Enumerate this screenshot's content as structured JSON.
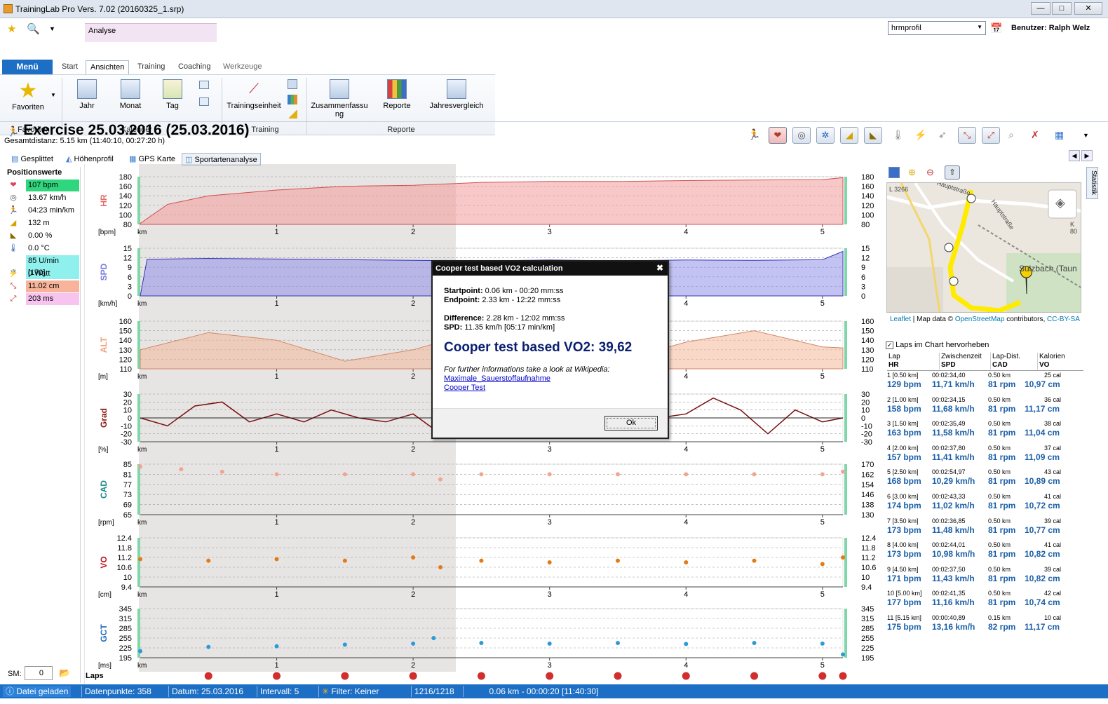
{
  "window": {
    "title": "TrainingLab Pro Vers. 7.02 (20160325_1.srp)",
    "min": "—",
    "max": "□",
    "close": "✕"
  },
  "ribbon": {
    "context_tab": "Analyse",
    "menu": "Menü",
    "tabs": [
      "Start",
      "Ansichten",
      "Training",
      "Coaching",
      "Werkzeuge"
    ],
    "profile": "hrmprofil",
    "user": "Benutzer: Ralph Welz",
    "buttons": {
      "favoriten": "Favoriten",
      "jahr": "Jahr",
      "monat": "Monat",
      "tag": "Tag",
      "trainingseinheit": "Trainingseinheit",
      "zusammenfassung": "Zusammenfassu\nng",
      "reporte": "Reporte",
      "jahresvergleich": "Jahresvergleich"
    },
    "groups": {
      "favoriten": "Favoriten",
      "kalender": "Kalender",
      "training": "Training",
      "reporte": "Reporte"
    }
  },
  "exercise": {
    "title": "Exercise 25.03.2016 (25.03.2016)",
    "subtitle": "Gesamtdistanz: 5.15 km (11:40:10, 00:27:20 h)"
  },
  "subtabs": [
    "Gesplittet",
    "Höhenprofil",
    "GPS Karte",
    "Sportartenanalyse"
  ],
  "positions": {
    "title": "Positionswerte",
    "rows": [
      {
        "icon": "heart-icon",
        "value": "107 bpm",
        "bg": "#2fd67e"
      },
      {
        "icon": "speed-icon",
        "value": "13.67 km/h",
        "bg": ""
      },
      {
        "icon": "runner-icon",
        "value": "04:23 min/km",
        "bg": ""
      },
      {
        "icon": "altitude-icon",
        "value": "132 m",
        "bg": ""
      },
      {
        "icon": "gradient-icon",
        "value": "0.00 %",
        "bg": ""
      },
      {
        "icon": "thermometer-icon",
        "value": "0.0 °C",
        "bg": ""
      },
      {
        "icon": "cadence-icon",
        "value": "85 U/min [170]",
        "bg": "#8ff0ee"
      },
      {
        "icon": "power-icon",
        "value": "0 Watt",
        "bg": ""
      },
      {
        "icon": "vertical-oscillation-icon",
        "value": "11.02 cm",
        "bg": "#f7b49a"
      },
      {
        "icon": "ground-contact-icon",
        "value": "203 ms",
        "bg": "#f7c3ef"
      }
    ]
  },
  "sm": {
    "label": "SM:",
    "value": "0"
  },
  "laps_label": "Laps",
  "chart_data": [
    {
      "type": "area",
      "name": "HR",
      "unit": "[bpm]",
      "ylim": [
        80,
        180
      ],
      "yticks": [
        80,
        100,
        120,
        140,
        160,
        180
      ],
      "xlabel": "km",
      "xticks": [
        1,
        2,
        3,
        4,
        5
      ],
      "x": [
        0,
        0.2,
        0.5,
        1,
        1.5,
        2,
        2.5,
        3,
        3.5,
        4,
        4.5,
        5,
        5.15
      ],
      "y": [
        82,
        122,
        140,
        152,
        160,
        162,
        168,
        170,
        170,
        172,
        173,
        174,
        178
      ]
    },
    {
      "type": "area",
      "name": "SPD",
      "unit": "[km/h]",
      "ylim": [
        0,
        15
      ],
      "yticks": [
        0,
        3,
        6,
        9,
        12,
        15
      ],
      "xlabel": "km",
      "xticks": [
        1,
        2,
        3,
        4,
        5
      ],
      "x": [
        0,
        0.05,
        0.5,
        1,
        1.5,
        2,
        2.5,
        3,
        3.5,
        4,
        4.5,
        5,
        5.15
      ],
      "y": [
        0,
        11.5,
        11.8,
        11.6,
        11.4,
        11.2,
        11.0,
        11.3,
        11.0,
        11.3,
        11.2,
        11.4,
        14
      ]
    },
    {
      "type": "area",
      "name": "ALT",
      "unit": "[m]",
      "ylim": [
        110,
        160
      ],
      "yticks": [
        110,
        120,
        130,
        140,
        150,
        160
      ],
      "xlabel": "km",
      "xticks": [
        1,
        2,
        3,
        4,
        5
      ],
      "x": [
        0,
        0.5,
        1,
        1.5,
        2,
        2.5,
        3,
        3.5,
        4,
        4.5,
        5,
        5.15
      ],
      "y": [
        130,
        148,
        140,
        118,
        130,
        150,
        148,
        118,
        138,
        150,
        133,
        132
      ]
    },
    {
      "type": "line",
      "name": "Grad",
      "unit": "[%]",
      "ylim": [
        -30,
        30
      ],
      "yticks": [
        -30,
        -20,
        -10,
        0,
        10,
        20,
        30
      ],
      "xlabel": "km",
      "xticks": [
        1,
        2,
        3,
        4,
        5
      ],
      "x": [
        0,
        0.2,
        0.4,
        0.6,
        0.8,
        1,
        1.2,
        1.4,
        1.6,
        1.8,
        2,
        2.2,
        2.4,
        2.6,
        2.8,
        3,
        3.2,
        3.4,
        3.6,
        3.8,
        4,
        4.2,
        4.4,
        4.6,
        4.8,
        5,
        5.15
      ],
      "y": [
        0,
        -10,
        15,
        20,
        -5,
        5,
        -5,
        10,
        0,
        -5,
        5,
        -20,
        20,
        -10,
        5,
        0,
        -5,
        5,
        -10,
        0,
        5,
        25,
        10,
        -20,
        10,
        -5,
        0
      ]
    },
    {
      "type": "scatter",
      "name": "CAD",
      "unit": "[rpm]",
      "ylim": [
        65,
        85
      ],
      "yticks": [
        65,
        69,
        73,
        77,
        81,
        85
      ],
      "y2ticks": [
        130,
        138,
        146,
        154,
        162,
        170
      ],
      "xlabel": "km",
      "xticks": [
        1,
        2,
        3,
        4,
        5
      ],
      "x": [
        0,
        0.3,
        0.6,
        1,
        1.5,
        2,
        2.2,
        2.5,
        3,
        3.5,
        4,
        4.5,
        5,
        5.15
      ],
      "y": [
        84,
        83,
        82,
        81,
        81,
        81,
        79,
        81,
        81,
        81,
        81,
        81,
        81,
        82
      ]
    },
    {
      "type": "scatter",
      "name": "VO",
      "unit": "[cm]",
      "ylim": [
        9.4,
        12.4
      ],
      "yticks": [
        9.4,
        10,
        10.6,
        11.2,
        11.8,
        12.4
      ],
      "xlabel": "km",
      "xticks": [
        1,
        2,
        3,
        4,
        5
      ],
      "x": [
        0,
        0.5,
        1,
        1.5,
        2,
        2.2,
        2.5,
        3,
        3.5,
        4,
        4.5,
        5,
        5.15
      ],
      "y": [
        11.1,
        11.0,
        11.1,
        11.0,
        11.2,
        10.6,
        11.0,
        10.9,
        11.0,
        10.9,
        11.0,
        10.8,
        11.2
      ]
    },
    {
      "type": "scatter",
      "name": "GCT",
      "unit": "[ms]",
      "ylim": [
        195,
        345
      ],
      "yticks": [
        195,
        225,
        255,
        285,
        315,
        345
      ],
      "xlabel": "km",
      "xticks": [
        1,
        2,
        3,
        4,
        5
      ],
      "x": [
        0,
        0.5,
        1,
        1.5,
        2,
        2.15,
        2.5,
        3,
        3.5,
        4,
        4.5,
        5,
        5.15
      ],
      "y": [
        215,
        228,
        230,
        235,
        238,
        255,
        240,
        238,
        240,
        237,
        240,
        238,
        205
      ]
    }
  ],
  "dialog": {
    "title": "Cooper test based VO2 calculation",
    "close": "✖",
    "startpoint_label": "Startpoint:",
    "startpoint": " 0.06 km - 00:20 mm:ss",
    "endpoint_label": "Endpoint:",
    "endpoint": " 2.33 km - 12:22 mm:ss",
    "difference_label": "Difference:",
    "difference": " 2.28 km - 12:02 mm:ss",
    "spd_label": "SPD:",
    "spd": " 11.35 km/h [05:17 min/km]",
    "result": "Cooper test based VO2: 39,62",
    "info": "For further informations take a look at Wikipedia:",
    "link1": "Maximale_Sauerstoffaufnahme",
    "link2": "Cooper Test",
    "ok": "Ok"
  },
  "map": {
    "attribution_leaflet": "Leaflet",
    "attribution_text": " | Map data © ",
    "osm": "OpenStreetMap",
    "contributors": " contributors, ",
    "ccbysa": "CC-BY-SA",
    "streets": [
      "Hauptstraße",
      "Hauptstraße",
      "L 3266",
      "Sulzbach (Taun",
      "K 80"
    ]
  },
  "laps": {
    "checkbox": "Laps im Chart hervorheben",
    "headers": [
      [
        "Lap",
        "HR"
      ],
      [
        "Zwischenzeit",
        "SPD"
      ],
      [
        "Lap-Dist.",
        "CAD"
      ],
      [
        "Kalorien",
        "VO"
      ]
    ],
    "rows": [
      {
        "lap": "1 [0.50 km]",
        "time": "00:02:34,40",
        "dist": "0.50 km",
        "cal": "25 cal",
        "hr": "129 bpm",
        "spd": "11,71 km/h",
        "cad": "81 rpm",
        "vo": "10,97 cm"
      },
      {
        "lap": "2 [1.00 km]",
        "time": "00:02:34,15",
        "dist": "0.50 km",
        "cal": "36 cal",
        "hr": "158 bpm",
        "spd": "11,68 km/h",
        "cad": "81 rpm",
        "vo": "11,17 cm"
      },
      {
        "lap": "3 [1.50 km]",
        "time": "00:02:35,49",
        "dist": "0.50 km",
        "cal": "38 cal",
        "hr": "163 bpm",
        "spd": "11,58 km/h",
        "cad": "81 rpm",
        "vo": "11,04 cm"
      },
      {
        "lap": "4 [2.00 km]",
        "time": "00:02:37,80",
        "dist": "0.50 km",
        "cal": "37 cal",
        "hr": "157 bpm",
        "spd": "11,41 km/h",
        "cad": "81 rpm",
        "vo": "11,09 cm"
      },
      {
        "lap": "5 [2.50 km]",
        "time": "00:02:54,97",
        "dist": "0.50 km",
        "cal": "43 cal",
        "hr": "168 bpm",
        "spd": "10,29 km/h",
        "cad": "81 rpm",
        "vo": "10,89 cm"
      },
      {
        "lap": "6 [3.00 km]",
        "time": "00:02:43,33",
        "dist": "0.50 km",
        "cal": "41 cal",
        "hr": "174 bpm",
        "spd": "11,02 km/h",
        "cad": "81 rpm",
        "vo": "10,72 cm"
      },
      {
        "lap": "7 [3.50 km]",
        "time": "00:02:36,85",
        "dist": "0.50 km",
        "cal": "39 cal",
        "hr": "173 bpm",
        "spd": "11,48 km/h",
        "cad": "81 rpm",
        "vo": "10,77 cm"
      },
      {
        "lap": "8 [4.00 km]",
        "time": "00:02:44,01",
        "dist": "0.50 km",
        "cal": "41 cal",
        "hr": "173 bpm",
        "spd": "10,98 km/h",
        "cad": "81 rpm",
        "vo": "10,82 cm"
      },
      {
        "lap": "9 [4.50 km]",
        "time": "00:02:37,50",
        "dist": "0.50 km",
        "cal": "39 cal",
        "hr": "171 bpm",
        "spd": "11,43 km/h",
        "cad": "81 rpm",
        "vo": "10,82 cm"
      },
      {
        "lap": "10 [5.00 km]",
        "time": "00:02:41,35",
        "dist": "0.50 km",
        "cal": "42 cal",
        "hr": "177 bpm",
        "spd": "11,16 km/h",
        "cad": "81 rpm",
        "vo": "10,74 cm"
      },
      {
        "lap": "11 [5.15 km]",
        "time": "00:00:40,89",
        "dist": "0.15 km",
        "cal": "10 cal",
        "hr": "175 bpm",
        "spd": "13,16 km/h",
        "cad": "82 rpm",
        "vo": "11,17 cm"
      }
    ]
  },
  "sidetab": "Statistik",
  "status": {
    "file": "Datei geladen",
    "points": "Datenpunkte: 358",
    "date": "Datum: 25.03.2016",
    "interval": "Intervall: 5",
    "filter": "Filter: Keiner",
    "count": "1216/1218",
    "position": "0.06 km - 00:00:20 [11:40:30]"
  }
}
